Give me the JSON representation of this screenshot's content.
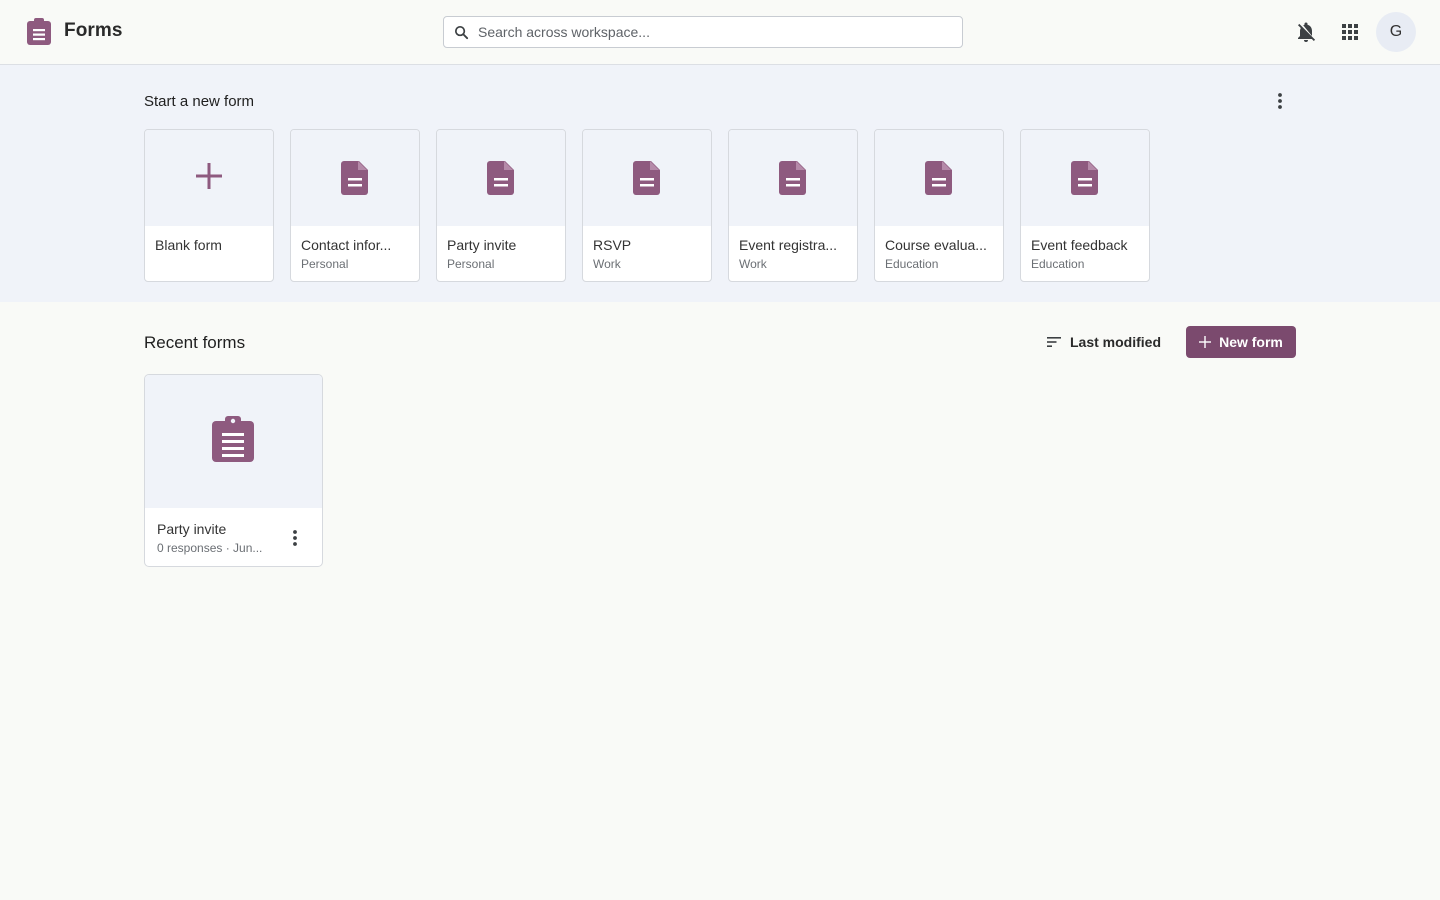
{
  "app": {
    "title": "Forms"
  },
  "search": {
    "placeholder": "Search across workspace..."
  },
  "header": {
    "avatar_initial": "G"
  },
  "templates": {
    "title": "Start a new form",
    "items": [
      {
        "name": "Blank form",
        "category": "",
        "icon": "plus-icon"
      },
      {
        "name": "Contact infor...",
        "category": "Personal",
        "icon": "document-icon"
      },
      {
        "name": "Party invite",
        "category": "Personal",
        "icon": "document-icon"
      },
      {
        "name": "RSVP",
        "category": "Work",
        "icon": "document-icon"
      },
      {
        "name": "Event registra...",
        "category": "Work",
        "icon": "document-icon"
      },
      {
        "name": "Course evalua...",
        "category": "Education",
        "icon": "document-icon"
      },
      {
        "name": "Event feedback",
        "category": "Education",
        "icon": "document-icon"
      }
    ]
  },
  "recent": {
    "title": "Recent forms",
    "sort_label": "Last modified",
    "new_button_label": "New form",
    "forms": [
      {
        "name": "Party invite",
        "meta": "0 responses · Jun..."
      }
    ]
  },
  "colors": {
    "accent": "#7b4a6e",
    "icon_purple": "#8e5a7f",
    "template_band": "#f0f3f9",
    "page_bg": "#f9faf7"
  }
}
